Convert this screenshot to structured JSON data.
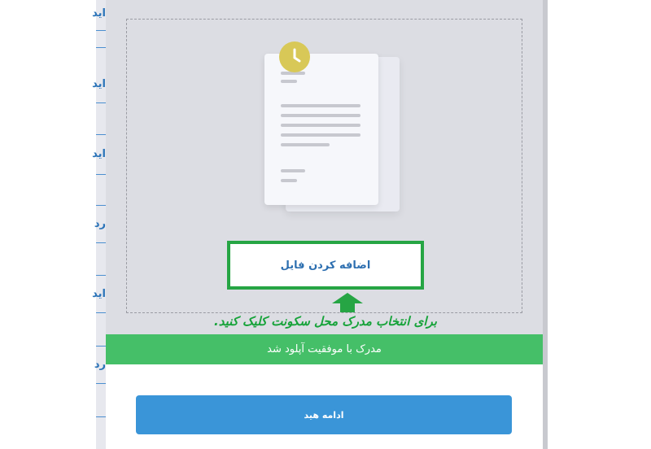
{
  "sidebar": {
    "items": [
      {
        "label": "ايد"
      },
      {
        "label": "ايد"
      },
      {
        "label": "ايد"
      },
      {
        "label": "رد"
      },
      {
        "label": "ايد"
      },
      {
        "label": "رد"
      }
    ]
  },
  "upload": {
    "add_file_label": "اضافه کردن فایل",
    "hint_text": "برای انتخاب مدرک محل سکونت کلیک کنید.",
    "success_message": "مدرک با موفقیت آپلود شد",
    "continue_label": "ادامه هید"
  },
  "colors": {
    "highlight": "#26a544",
    "success": "#45bf68",
    "primary": "#3a95d8",
    "clock": "#d8c857"
  },
  "icons": [
    "document-icon",
    "clock-icon",
    "up-arrow-icon"
  ]
}
